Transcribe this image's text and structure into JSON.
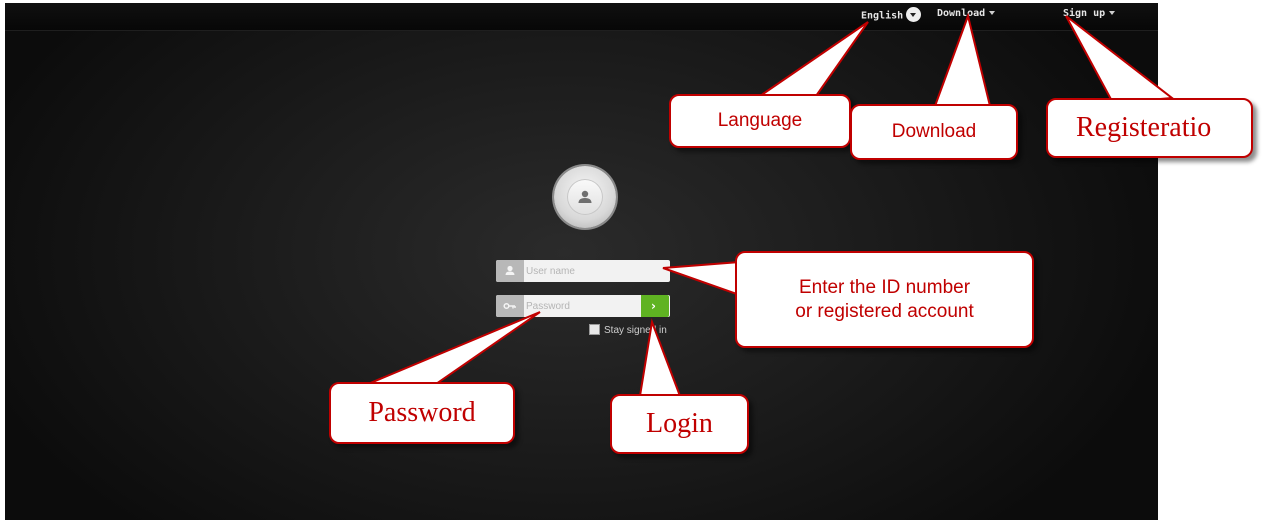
{
  "topbar": {
    "language_label": "English",
    "download_label": "Download",
    "signup_label": "Sign up"
  },
  "login_form": {
    "username_placeholder": "User name",
    "password_placeholder": "Password",
    "login_button_glyph": "›",
    "stay_signed_in_label": "Stay signed in"
  },
  "annotations": {
    "language": "Language",
    "download": "Download",
    "registration": "Registeratio",
    "id_line1": "Enter the ID number",
    "id_line2": "or registered account",
    "password": "Password",
    "login": "Login"
  },
  "colors": {
    "callout_border": "#c00000",
    "callout_text": "#c00000",
    "login_button": "#5fb322",
    "background": "#1a1a1a"
  },
  "icons": {
    "username_field": "user-icon",
    "password_field": "key-icon",
    "avatar": "user-icon",
    "language": "chevron-down-circle-icon"
  }
}
